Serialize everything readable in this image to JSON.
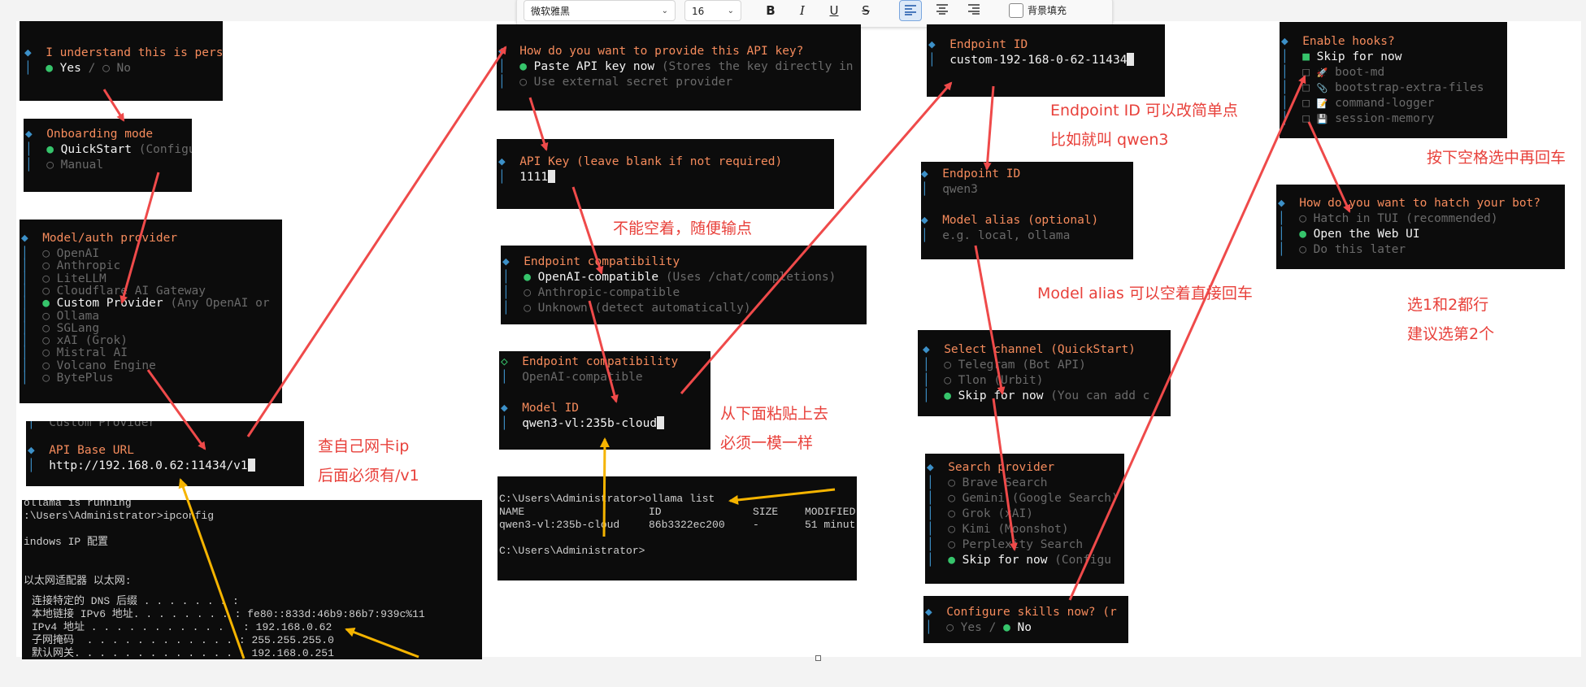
{
  "toolbar": {
    "font_family": "微软雅黑",
    "font_size": "16",
    "bold_icon": "B",
    "italic_icon": "I",
    "underline_icon": "U",
    "strike_icon": "S",
    "bg_fill_label": "背景填充"
  },
  "panels": {
    "understand": {
      "title": "I understand this is personal",
      "yes": "Yes",
      "sep": "/",
      "no": "No"
    },
    "onboarding": {
      "title": "Onboarding mode",
      "opt1": "QuickStart",
      "opt1_hint": "(Configure",
      "opt2": "Manual"
    },
    "provider": {
      "title": "Model/auth provider",
      "items": [
        "OpenAI",
        "Anthropic",
        "LiteLLM",
        "Cloudflare AI Gateway",
        "Custom Provider",
        "Ollama",
        "SGLang",
        "xAI (Grok)",
        "Mistral AI",
        "Volcano Engine",
        "BytePlus"
      ],
      "selected_hint": "(Any OpenAI or"
    },
    "baseurl": {
      "prev": "Custom Provider",
      "title": "API Base URL",
      "value": "http://192.168.0.62:11434/v1"
    },
    "apikey_mode": {
      "title": "How do you want to provide this API key?",
      "opt1": "Paste API key now",
      "opt1_hint": "(Stores the key directly in",
      "opt2": "Use external secret provider"
    },
    "apikey": {
      "title": "API Key (leave blank if not required)",
      "value": "1111"
    },
    "compat": {
      "title": "Endpoint compatibility",
      "opt1": "OpenAI-compatible",
      "opt1_hint": "(Uses /chat/completions)",
      "opt2": "Anthropic-compatible",
      "opt3": "Unknown (detect automatically)"
    },
    "model": {
      "compat_title": "Endpoint compatibility",
      "compat_value": "OpenAI-compatible",
      "title": "Model ID",
      "value": "qwen3-vl:235b-cloud"
    },
    "endpoint1": {
      "title": "Endpoint ID",
      "value": "custom-192-168-0-62-11434"
    },
    "endpoint2": {
      "title": "Endpoint ID",
      "value": "qwen3",
      "alias_title": "Model alias (optional)",
      "alias_placeholder": "e.g. local, ollama"
    },
    "channel": {
      "title": "Select channel (QuickStart)",
      "opt1": "Telegram (Bot API)",
      "opt2": "Tlon (Urbit)",
      "opt3": "Skip for now",
      "opt3_hint": "(You can add c"
    },
    "search": {
      "title": "Search provider",
      "items": [
        "Brave Search",
        "Gemini (Google Search)",
        "Grok (xAI)",
        "Kimi (Moonshot)",
        "Perplexity Search"
      ],
      "skip": "Skip for now",
      "skip_hint": "(Configu"
    },
    "skills": {
      "title": "Configure skills now? (r",
      "yes": "Yes",
      "sep": "/",
      "no": "No"
    },
    "hooks": {
      "title": "Enable hooks?",
      "skip": "Skip for now",
      "items": [
        "boot-md",
        "bootstrap-extra-files",
        "command-logger",
        "session-memory"
      ]
    },
    "hatch": {
      "title": "How do you want to hatch your bot?",
      "opt1": "Hatch in TUI (recommended)",
      "opt2": "Open the Web UI",
      "opt3": "Do this later"
    }
  },
  "ipconfig": {
    "line1": "ollama is running",
    "line2": ":\\Users\\Administrator>ipconfig",
    "line3": "indows IP 配置",
    "line4": "以太网适配器 以太网:",
    "rows": [
      {
        "label": "连接特定的 DNS 后缀 . . . . . . . :",
        "value": ""
      },
      {
        "label": "本地链接 IPv6 地址. . . . . . . . :",
        "value": "fe80::833d:46b9:86b7:939c%11"
      },
      {
        "label": "IPv4 地址 . . . . . . . . . . . . :",
        "value": "192.168.0.62"
      },
      {
        "label": "子网掩码  . . . . . . . . . . . . :",
        "value": "255.255.255.0"
      },
      {
        "label": "默认网关. . . . . . . . . . . . . :",
        "value": "192.168.0.251"
      }
    ]
  },
  "ollama_list": {
    "prompt": "C:\\Users\\Administrator>ollama list",
    "headers": [
      "NAME",
      "ID",
      "SIZE",
      "MODIFIED"
    ],
    "row": [
      "qwen3-vl:235b-cloud",
      "86b3322ec200",
      "-",
      "51 minut"
    ],
    "prompt2": "C:\\Users\\Administrator>"
  },
  "notes": {
    "ip_1": "查自己网卡ip",
    "ip_2": "后面必须有/v1",
    "blank": "不能空着，随便输点",
    "paste_1": "从下面粘贴上去",
    "paste_2": "必须一模一样",
    "endpoint_1": "Endpoint ID 可以改简单点",
    "endpoint_2": "比如就叫 qwen3",
    "alias": "Model alias 可以空着直接回车",
    "space": "按下空格选中再回车",
    "choice_1": "选1和2都行",
    "choice_2": "建议选第2个"
  },
  "colors": {
    "arrow_red": "#ef4a4a",
    "arrow_yellow": "#f5b400",
    "accent_orange": "#f58b5c",
    "selected_green": "#36c46b",
    "note_red": "#e8413b"
  }
}
